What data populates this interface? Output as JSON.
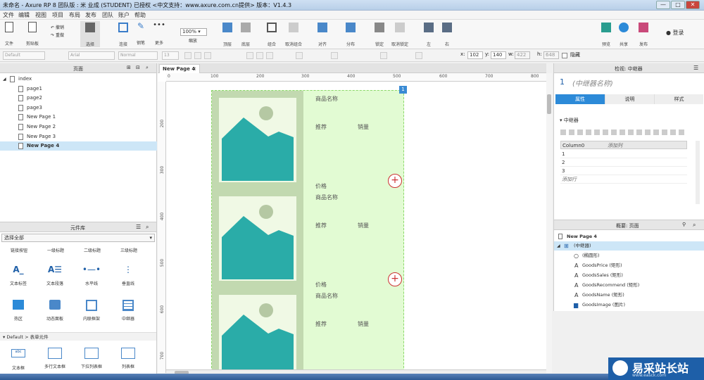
{
  "window": {
    "title": "未命名 - Axure RP 8 团队版 : 米 业成 (STUDENT) 已授权      <中文支持：www.axure.com.cn提供> 版本：V1.4.3",
    "controls": [
      "—",
      "□",
      "✕"
    ]
  },
  "menu": [
    "文件",
    "编辑",
    "视图",
    "项目",
    "布局",
    "发布",
    "团队",
    "账户",
    "帮助"
  ],
  "toolbar": {
    "file": "文件",
    "clipboard": "剪贴板",
    "undo": "撤销",
    "redo": "重做",
    "select": "选择",
    "connect": "连接",
    "pen": "钢笔",
    "more": "更多",
    "zoom_value": "100%",
    "zoom_label": "缩放",
    "top": "顶层",
    "bottom": "底层",
    "group": "组合",
    "ungroup": "取消组合",
    "align": "对齐",
    "distribute": "分布",
    "lock": "锁定",
    "unlock": "取消锁定",
    "left": "左",
    "right": "右",
    "preview": "预览",
    "share": "共享",
    "publish": "发布",
    "login": "登录"
  },
  "format": {
    "style": "Default",
    "font": "Arial",
    "weight": "Normal",
    "size": "13",
    "x_label": "x:",
    "x_value": "102",
    "y_label": "y:",
    "y_value": "140",
    "w_label": "w:",
    "w_value": "422",
    "h_label": "h:",
    "h_value": "648",
    "hidden_label": "隐藏"
  },
  "pages_panel": {
    "title": "页面",
    "root": "index",
    "items": [
      "page1",
      "page2",
      "page3",
      "New Page 1",
      "New Page 2",
      "New Page 3",
      "New Page 4"
    ],
    "selected_index": 6
  },
  "widgets_panel": {
    "title": "元件库",
    "library": "选择全部",
    "categories": [
      "链接按钮",
      "一级标题",
      "二级标题",
      "三级标题"
    ],
    "row1": [
      "文本标签",
      "文本段落",
      "水平线",
      "垂直线"
    ],
    "row2": [
      "热区",
      "动态面板",
      "内联框架",
      "中继器"
    ],
    "section": "Default > 表单元件",
    "row3": [
      "文本框",
      "多行文本框",
      "下拉列表框",
      "列表框"
    ]
  },
  "canvas": {
    "tab": "New Page 4",
    "ruler_h": [
      "0",
      "100",
      "200",
      "300",
      "400",
      "500",
      "600",
      "700",
      "800"
    ],
    "ruler_v": [
      "200",
      "300",
      "400",
      "500",
      "600",
      "700"
    ],
    "badge": "1",
    "items": [
      {
        "name": "商品名称",
        "recommend": "推荐",
        "sales": "销量",
        "price": "价格"
      },
      {
        "name": "商品名称",
        "recommend": "推荐",
        "sales": "销量",
        "price": "价格"
      },
      {
        "name": "商品名称",
        "recommend": "推荐",
        "sales": "销量"
      }
    ]
  },
  "inspector": {
    "header": "检视: 中继器",
    "index": "1",
    "placeholder": "(中继器名称)",
    "tabs": [
      "属性",
      "说明",
      "样式"
    ],
    "section": "中继器",
    "columns": [
      "Column0",
      "添加列"
    ],
    "rows": [
      "1",
      "2",
      "3"
    ],
    "add_row": "添加行"
  },
  "outline": {
    "title": "概要: 页面",
    "page": "New Page 4",
    "root": "(中继器)",
    "items": [
      "(椭圆形)",
      "GoodsPrice (矩形)",
      "GoodsSales (矩形)",
      "GoodsRecommend (矩形)",
      "GoodsName (矩形)",
      "GoodsImage (图片)"
    ]
  },
  "watermark": {
    "brand": "易采站长站",
    "url": "www.easck.com"
  },
  "colors": {
    "repeater_bg": "#e2fbd3",
    "repeater_left": "#c2d9b0",
    "image_teal": "#2aaca8",
    "plus_red": "#cc3333",
    "accent_blue": "#3a8bd4"
  }
}
